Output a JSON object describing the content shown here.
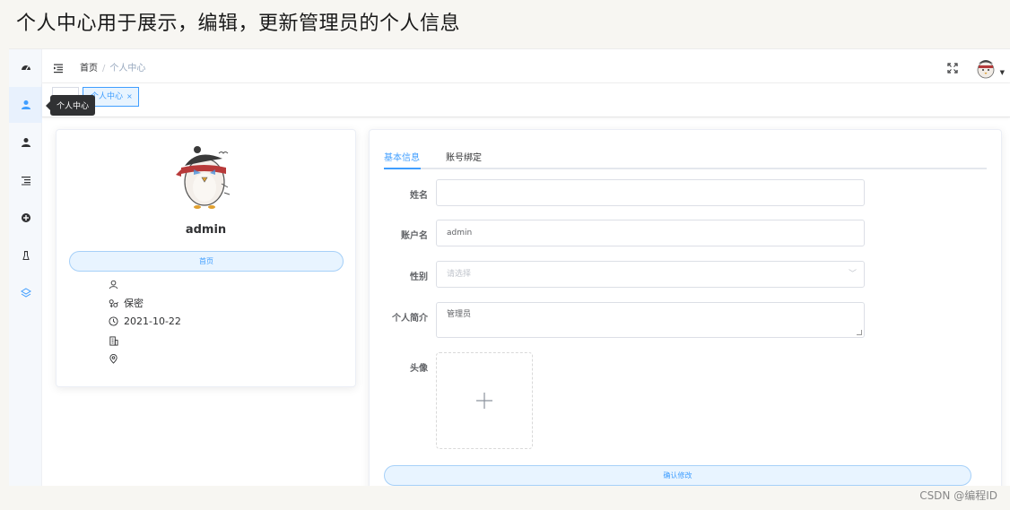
{
  "caption": "个人中心用于展示，编辑，更新管理员的个人信息",
  "watermark": "CSDN @编程ID",
  "sidebar": {
    "items": [
      {
        "icon": "dashboard-icon"
      },
      {
        "icon": "user-icon",
        "active": true
      },
      {
        "icon": "user-icon"
      },
      {
        "icon": "list-icon"
      },
      {
        "icon": "circle-icon"
      },
      {
        "icon": "flask-icon"
      },
      {
        "icon": "layers-icon"
      }
    ],
    "tooltip": "个人中心"
  },
  "topbar": {
    "breadcrumb_home": "首页",
    "breadcrumb_sep": "/",
    "breadcrumb_current": "个人中心"
  },
  "tags": {
    "active_label": "个人中心",
    "close": "×"
  },
  "profile": {
    "username": "admin",
    "role_label": "首页",
    "gender": "保密",
    "date": "2021-10-22"
  },
  "form": {
    "tabs": [
      "基本信息",
      "账号绑定"
    ],
    "active_tab": 0,
    "fields": {
      "name_label": "姓名",
      "name_value": "",
      "account_label": "账户名",
      "account_value": "admin",
      "gender_label": "性别",
      "gender_placeholder": "请选择",
      "bio_label": "个人简介",
      "bio_value": "管理员",
      "avatar_label": "头像"
    },
    "submit_label": "确认修改"
  },
  "colors": {
    "primary": "#409eff",
    "pill_bg": "#e8f4ff",
    "pill_border": "#a6d0f8",
    "sidebar_bg": "#f5f8fc"
  }
}
